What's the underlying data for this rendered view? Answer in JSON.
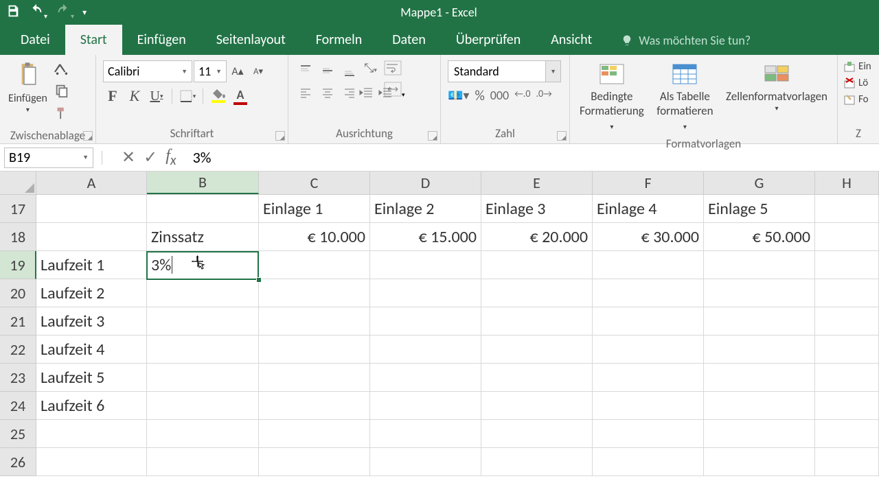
{
  "app": {
    "title": "Mappe1 - Excel"
  },
  "tabs": {
    "datei": "Datei",
    "start": "Start",
    "einfuegen": "Einfügen",
    "seitenlayout": "Seitenlayout",
    "formeln": "Formeln",
    "daten": "Daten",
    "ueberpruefen": "Überprüfen",
    "ansicht": "Ansicht",
    "tellme": "Was möchten Sie tun?"
  },
  "ribbon": {
    "zwischenablage": {
      "label": "Zwischenablage",
      "einfuegen": "Einfügen"
    },
    "schriftart": {
      "label": "Schriftart",
      "font": "Calibri",
      "size": "11"
    },
    "ausrichtung": {
      "label": "Ausrichtung"
    },
    "zahl": {
      "label": "Zahl",
      "format": "Standard"
    },
    "formatvorlagen": {
      "label": "Formatvorlagen",
      "bedingte_l1": "Bedingte",
      "bedingte_l2": "Formatierung",
      "tabelle_l1": "Als Tabelle",
      "tabelle_l2": "formatieren",
      "zellen": "Zellenformatvorlagen"
    },
    "zellen_grp": {
      "ein": "Ein",
      "loe": "Lö",
      "for": "Fo"
    }
  },
  "name_box": "B19",
  "formula_value": "3%",
  "columns": [
    "A",
    "B",
    "C",
    "D",
    "E",
    "F",
    "G",
    "H"
  ],
  "rows": [
    "17",
    "18",
    "19",
    "20",
    "21",
    "22",
    "23",
    "24",
    "25",
    "26"
  ],
  "cells": {
    "C17": "Einlage 1",
    "D17": "Einlage 2",
    "E17": "Einlage 3",
    "F17": "Einlage 4",
    "G17": "Einlage 5",
    "B18": "Zinssatz",
    "C18": "€ 10.000",
    "D18": "€ 15.000",
    "E18": "€ 20.000",
    "F18": "€ 30.000",
    "G18": "€ 50.000",
    "A19": "Laufzeit 1",
    "B19": "3%",
    "A20": "Laufzeit 2",
    "A21": "Laufzeit 3",
    "A22": "Laufzeit 4",
    "A23": "Laufzeit 5",
    "A24": "Laufzeit 6"
  },
  "active_cell": "B19",
  "selected_col": "B",
  "selected_row": "19"
}
